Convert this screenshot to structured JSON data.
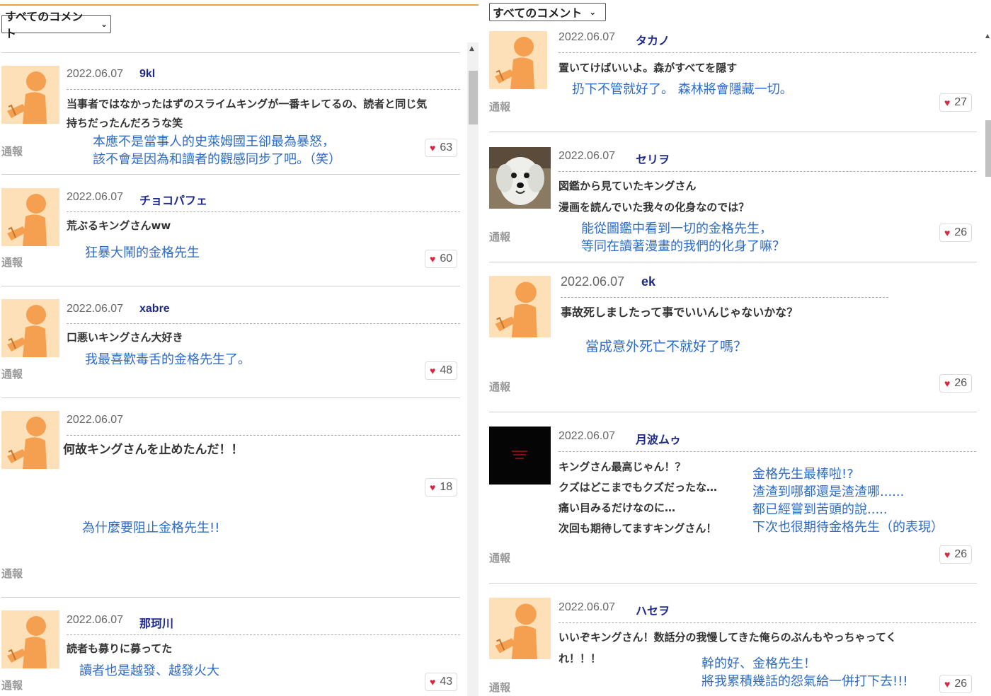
{
  "left": {
    "filter": {
      "selected": "すべてのコメント"
    },
    "report_label": "通報",
    "comments": [
      {
        "date": "2022.06.07",
        "author": "9kl",
        "text": [
          "当事者ではなかったはずのスライムキングが一番キレてるの、読者と同じ気",
          "持ちだったんだろうな笑"
        ],
        "translation": [
          "本應不是當事人的史萊姆國王卻最為暴怒，",
          "該不會是因為和讀者的觀感同步了吧。（笑）"
        ],
        "likes": "63"
      },
      {
        "date": "2022.06.07",
        "author": "チョコパフェ",
        "text": [
          "荒ぶるキングさんww"
        ],
        "translation": [
          "狂暴大鬧的金格先生"
        ],
        "likes": "60"
      },
      {
        "date": "2022.06.07",
        "author": "xabre",
        "text": [
          "口悪いキングさん大好き"
        ],
        "translation": [
          "我最喜歡毒舌的金格先生了。"
        ],
        "likes": "48"
      },
      {
        "date": "2022.06.07",
        "author": "",
        "text": [
          "何故キングさんを止めたんだ！！"
        ],
        "translation": [
          "為什麼要阻止金格先生!!"
        ],
        "likes": "18"
      },
      {
        "date": "2022.06.07",
        "author": "那珂川",
        "text": [
          "読者も募りに募ってた"
        ],
        "translation": [
          "讀者也是越發、越發火大"
        ],
        "likes": "43"
      }
    ]
  },
  "right": {
    "filter": {
      "selected": "すべてのコメント"
    },
    "report_label": "通報",
    "comments": [
      {
        "date": "2022.06.07",
        "author": "タカノ",
        "text": [
          "置いてけばいいよ。森がすべてを隠す"
        ],
        "translation": [
          "扔下不管就好了。 森林將會隱藏一切。"
        ],
        "likes": "27"
      },
      {
        "date": "2022.06.07",
        "author": "セリヲ",
        "text": [
          "図鑑から見ていたキングさん",
          "漫画を読んでいた我々の化身なのでは？"
        ],
        "translation": [
          "能從圖鑑中看到一切的金格先生，",
          "等同在讀著漫畫的我們的化身了嘛？"
        ],
        "likes": "26"
      },
      {
        "date": "2022.06.07",
        "author": "ek",
        "text": [
          "事故死しましたって事でいいんじゃないかな？"
        ],
        "translation": [
          "當成意外死亡不就好了嗎？"
        ],
        "likes": "26"
      },
      {
        "date": "2022.06.07",
        "author": "月波ムゥ",
        "text": [
          "キングさん最高じゃん！？",
          "クズはどこまでもクズだったな…",
          "痛い目みるだけなのに…",
          "次回も期待してますキングさん！"
        ],
        "translation": [
          "金格先生最棒啦!?",
          "渣渣到哪都還是渣渣哪......",
          "都已經嘗到苦頭的說.....",
          "下次也很期待金格先生（的表現）"
        ],
        "likes": "26"
      },
      {
        "date": "2022.06.07",
        "author": "ハセヲ",
        "text": [
          "いいぞキングさん！数話分の我慢してきた俺らのぶんもやっちゃってく",
          "れ！！！"
        ],
        "translation": [
          "幹的好、金格先生！",
          "將我累積幾話的怨氣給一併打下去!!!"
        ],
        "likes": "26"
      }
    ]
  },
  "colors": {
    "accent_line": "#e8a33a",
    "author": "#1e2a8a",
    "translation": "#2e6bc4",
    "heart": "#d7263d"
  },
  "icons": {
    "like": "heart-icon",
    "dropdown": "chevron-down-icon",
    "scroll": "scroll-up-arrow-icon"
  }
}
